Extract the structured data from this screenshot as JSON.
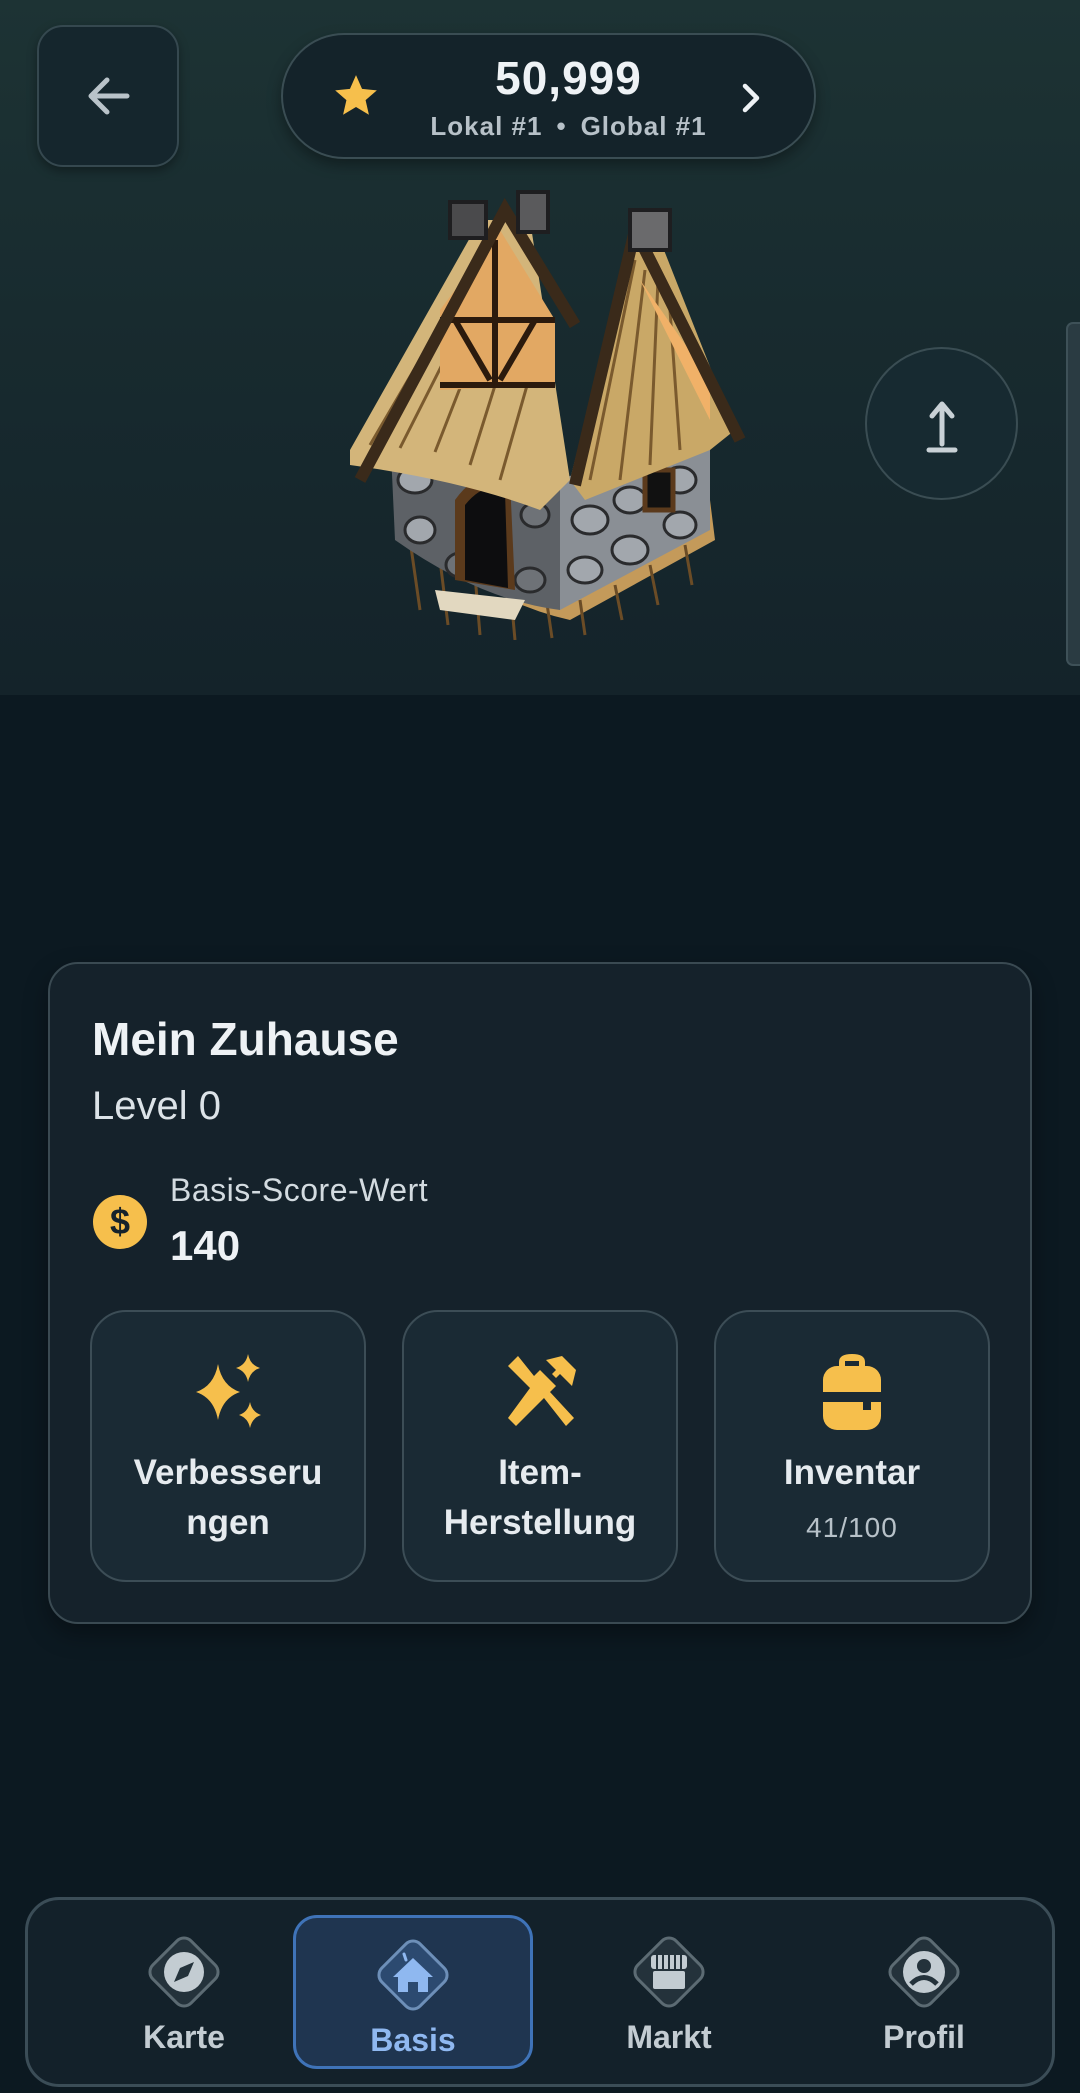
{
  "header": {
    "back_icon": "arrow-left-icon",
    "score": "50,999",
    "rank_local": "Lokal #1",
    "rank_separator": "•",
    "rank_global": "Global #1",
    "star_icon": "star-icon",
    "chevron_icon": "chevron-right-icon"
  },
  "hero": {
    "image": "house-illustration",
    "upload_icon": "upload-icon"
  },
  "home_card": {
    "title": "Mein Zuhause",
    "level": "Level 0",
    "score_label": "Basis-Score-Wert",
    "score_value": "140",
    "coin_icon": "dollar-coin-icon"
  },
  "actions": [
    {
      "label": "Verbesseru ngen",
      "icon": "sparkles-icon"
    },
    {
      "label": "Item-\nHerstellung",
      "icon": "hammer-wrench-icon"
    },
    {
      "label": "Inventar",
      "sub": "41/100",
      "icon": "backpack-icon"
    }
  ],
  "nav": [
    {
      "label": "Karte",
      "icon": "compass-icon",
      "active": false
    },
    {
      "label": "Basis",
      "icon": "home-icon",
      "active": true
    },
    {
      "label": "Markt",
      "icon": "store-icon",
      "active": false
    },
    {
      "label": "Profil",
      "icon": "profile-icon",
      "active": false
    }
  ],
  "colors": {
    "accent_gold": "#f6bf4c",
    "nav_active": "#3f73b8",
    "background": "#0c1921"
  }
}
